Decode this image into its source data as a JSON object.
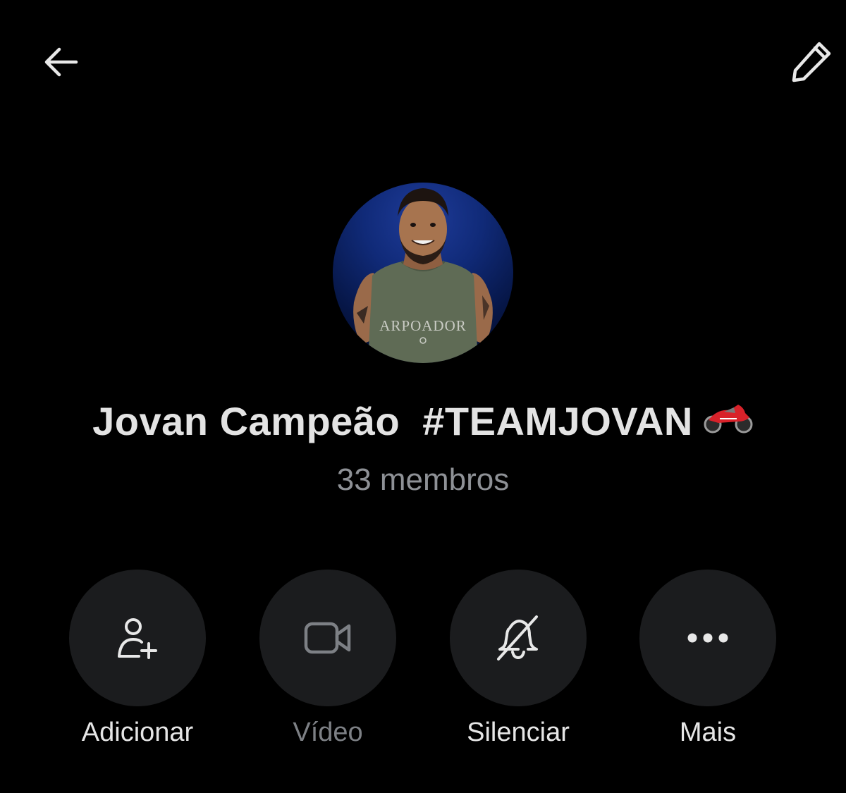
{
  "header": {
    "back_icon": "arrow-left-icon",
    "edit_icon": "pencil-icon"
  },
  "profile": {
    "name": "Jovan Campeão  #TEAMJOVAN",
    "name_emoji": "motorcycle-emoji",
    "members": "33 membros",
    "avatar_shirt_text": "ARPOADOR"
  },
  "actions": [
    {
      "label": "Adicionar",
      "icon": "add-person-icon",
      "enabled": true
    },
    {
      "label": "Vídeo",
      "icon": "video-camera-icon",
      "enabled": false
    },
    {
      "label": "Silenciar",
      "icon": "bell-off-icon",
      "enabled": true
    },
    {
      "label": "Mais",
      "icon": "more-dots-icon",
      "enabled": true
    }
  ],
  "colors": {
    "background": "#000000",
    "action_circle": "#1b1c1e",
    "title_text": "#e3e3e3",
    "subtitle_text": "#8e9196",
    "disabled_text": "#7d8085"
  }
}
